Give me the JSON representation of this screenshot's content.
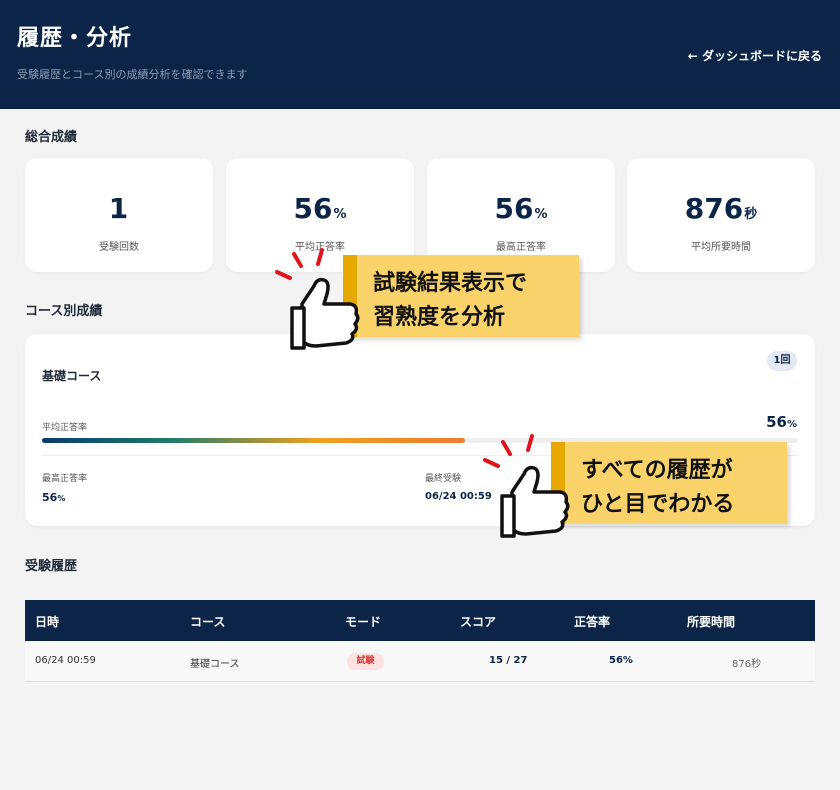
{
  "header": {
    "title": "履歴・分析",
    "subtitle": "受験履歴とコース別の成績分析を確認できます",
    "back_label": "← ダッシュボードに戻る"
  },
  "overall": {
    "title": "総合成績",
    "stats": [
      {
        "value": "1",
        "unit": "",
        "label": "受験回数"
      },
      {
        "value": "56",
        "unit": "%",
        "label": "平均正答率"
      },
      {
        "value": "56",
        "unit": "%",
        "label": "最高正答率"
      },
      {
        "value": "876",
        "unit": "秒",
        "label": "平均所要時間"
      }
    ]
  },
  "course_section": {
    "title": "コース別成績",
    "course": {
      "name": "基礎コース",
      "count_badge": "1回",
      "avg_label": "平均正答率",
      "avg_value": "56",
      "avg_unit": "%",
      "progress_percent": 56,
      "best_label": "最高正答率",
      "best_value": "56",
      "best_unit": "%",
      "last_label": "最終受験",
      "last_value": "06/24 00:59"
    }
  },
  "history": {
    "title": "受験履歴",
    "columns": [
      "日時",
      "コース",
      "モード",
      "スコア",
      "正答率",
      "所要時間"
    ],
    "rows": [
      {
        "datetime": "06/24 00:59",
        "course": "基礎コース",
        "mode": "試験",
        "score": "15 / 27",
        "rate": "56%",
        "time": "876秒"
      }
    ]
  },
  "promos": [
    {
      "lines": [
        "試験結果表示で",
        "習熟度を分析"
      ]
    },
    {
      "lines": [
        "すべての履歴が",
        "ひと目でわかる"
      ]
    }
  ],
  "colors": {
    "header_bg": "#0b2447",
    "accent": "#0b2447",
    "promo_bg": "#f9d36a",
    "promo_bar": "#e6a700",
    "badge_red": "#d63a3a"
  }
}
